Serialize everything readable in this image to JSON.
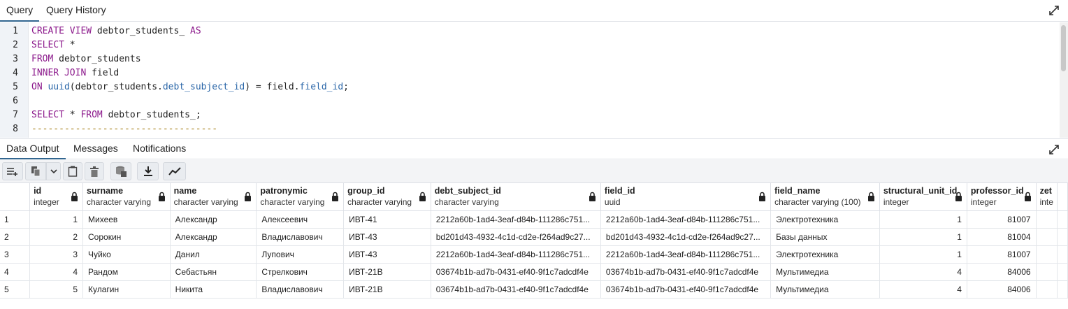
{
  "tabs": [
    {
      "label": "Query"
    },
    {
      "label": "Query History"
    }
  ],
  "editor": {
    "line_numbers": [
      "1",
      "2",
      "3",
      "4",
      "5",
      "6",
      "7",
      "8"
    ]
  },
  "output_tabs": [
    {
      "label": "Data Output"
    },
    {
      "label": "Messages"
    },
    {
      "label": "Notifications"
    }
  ],
  "toolbar": {
    "icons": [
      "add-row-icon",
      "copy-icon",
      "copy-dropdown-icon",
      "paste-icon",
      "delete-icon",
      "save-data-icon",
      "download-icon",
      "graph-icon"
    ]
  },
  "grid": {
    "columns": [
      {
        "name": "id",
        "type": "integer"
      },
      {
        "name": "surname",
        "type": "character varying"
      },
      {
        "name": "name",
        "type": "character varying"
      },
      {
        "name": "patronymic",
        "type": "character varying"
      },
      {
        "name": "group_id",
        "type": "character varying"
      },
      {
        "name": "debt_subject_id",
        "type": "character varying"
      },
      {
        "name": "field_id",
        "type": "uuid"
      },
      {
        "name": "field_name",
        "type": "character varying (100)"
      },
      {
        "name": "structural_unit_id",
        "type": "integer"
      },
      {
        "name": "professor_id",
        "type": "integer"
      },
      {
        "name": "zet",
        "type": "inte"
      }
    ],
    "rows": [
      {
        "rn": "1",
        "cells": [
          "1",
          "Михеев",
          "Александр",
          "Алексеевич",
          "ИВТ-41",
          "2212a60b-1ad4-3eaf-d84b-111286c751...",
          "2212a60b-1ad4-3eaf-d84b-111286c751...",
          "Электротехника",
          "1",
          "81007",
          ""
        ]
      },
      {
        "rn": "2",
        "cells": [
          "2",
          "Сорокин",
          "Александр",
          "Владиславович",
          "ИВТ-43",
          "bd201d43-4932-4c1d-cd2e-f264ad9c27...",
          "bd201d43-4932-4c1d-cd2e-f264ad9c27...",
          "Базы данных",
          "1",
          "81004",
          ""
        ]
      },
      {
        "rn": "3",
        "cells": [
          "3",
          "Чуйко",
          "Данил",
          "Лупович",
          "ИВТ-43",
          "2212a60b-1ad4-3eaf-d84b-111286c751...",
          "2212a60b-1ad4-3eaf-d84b-111286c751...",
          "Электротехника",
          "1",
          "81007",
          ""
        ]
      },
      {
        "rn": "4",
        "cells": [
          "4",
          "Рандом",
          "Себастьян",
          "Стрелкович",
          "ИВТ-21В",
          "03674b1b-ad7b-0431-ef40-9f1c7adcdf4e",
          "03674b1b-ad7b-0431-ef40-9f1c7adcdf4e",
          "Мультимедиа",
          "4",
          "84006",
          ""
        ]
      },
      {
        "rn": "5",
        "cells": [
          "5",
          "Кулагин",
          "Никита",
          "Владиславович",
          "ИВТ-21В",
          "03674b1b-ad7b-0431-ef40-9f1c7adcdf4e",
          "03674b1b-ad7b-0431-ef40-9f1c7adcdf4e",
          "Мультимедиа",
          "4",
          "84006",
          ""
        ]
      }
    ]
  },
  "colors": {
    "accent": "#326690",
    "keyword": "#8c1a8c",
    "function": "#2a66a8",
    "comment": "#a0780a"
  }
}
